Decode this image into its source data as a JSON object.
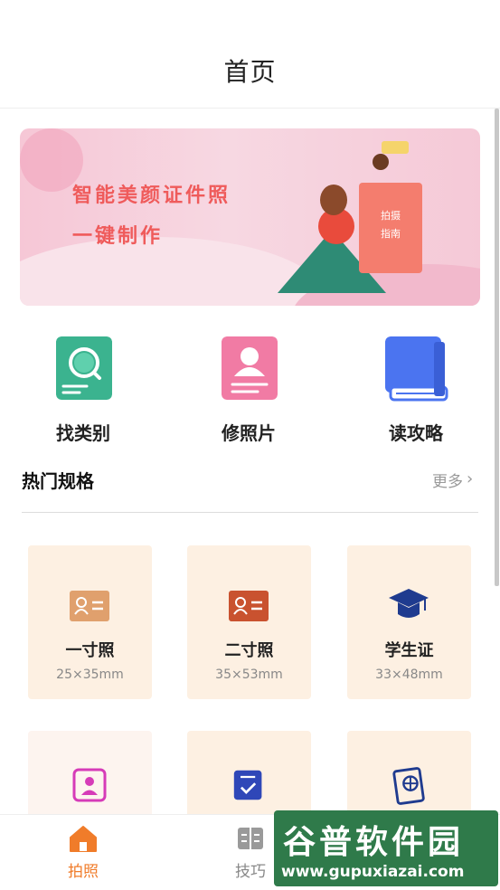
{
  "header": {
    "title": "首页"
  },
  "banner": {
    "line1": "智能美颜证件照",
    "line2": "一键制作",
    "book_text1": "拍摄",
    "book_text2": "指南"
  },
  "features": [
    {
      "label": "找类别",
      "icon": "search-card-icon",
      "color": "#3bb38f"
    },
    {
      "label": "修照片",
      "icon": "portrait-card-icon",
      "color": "#f17ba4"
    },
    {
      "label": "读攻略",
      "icon": "book-icon",
      "color": "#4b74f0"
    }
  ],
  "section": {
    "title": "热门规格",
    "more": "更多"
  },
  "specs": [
    {
      "name": "一寸照",
      "size": "25×35mm",
      "icon": "id-card-icon"
    },
    {
      "name": "二寸照",
      "size": "35×53mm",
      "icon": "id-card-icon"
    },
    {
      "name": "学生证",
      "size": "33×48mm",
      "icon": "graduation-cap-icon"
    },
    {
      "name": "",
      "size": "",
      "icon": "portrait-frame-icon"
    },
    {
      "name": "",
      "size": "",
      "icon": "checklist-icon"
    },
    {
      "name": "",
      "size": "",
      "icon": "passport-icon"
    }
  ],
  "tabs": [
    {
      "label": "拍照",
      "icon": "home-icon",
      "active": true
    },
    {
      "label": "技巧",
      "icon": "guide-icon",
      "active": false
    }
  ],
  "watermark": {
    "line1": "谷普软件园",
    "line2": "www.gupuxiazai.com"
  },
  "colors": {
    "accent": "#f07c2a",
    "card_bg": "#fdf0e2",
    "banner_text": "#ef5b5b"
  }
}
